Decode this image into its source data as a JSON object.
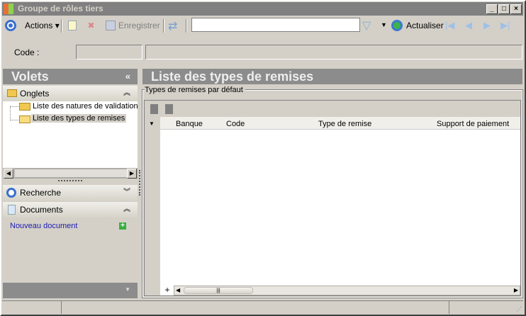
{
  "window": {
    "title": "Groupe de rôles tiers",
    "minimize": "_",
    "maximize": "□",
    "close": "×"
  },
  "toolbar": {
    "actions": "Actions",
    "save": "Enregistrer",
    "search_value": "",
    "refresh": "Actualiser"
  },
  "form": {
    "code_label": "Code :"
  },
  "left": {
    "title": "Volets",
    "collapse": "«",
    "tabs_section": "Onglets",
    "tree": [
      "Liste des natures de validation",
      "Liste des types de remises"
    ],
    "search_section": "Recherche",
    "documents_section": "Documents",
    "new_document": "Nouveau document"
  },
  "main": {
    "title": "Liste des types de remises",
    "group_label": "Types de remises par défaut",
    "columns": [
      "Banque",
      "Code",
      "Type de remise",
      "Support de paiement"
    ],
    "add": "+"
  }
}
